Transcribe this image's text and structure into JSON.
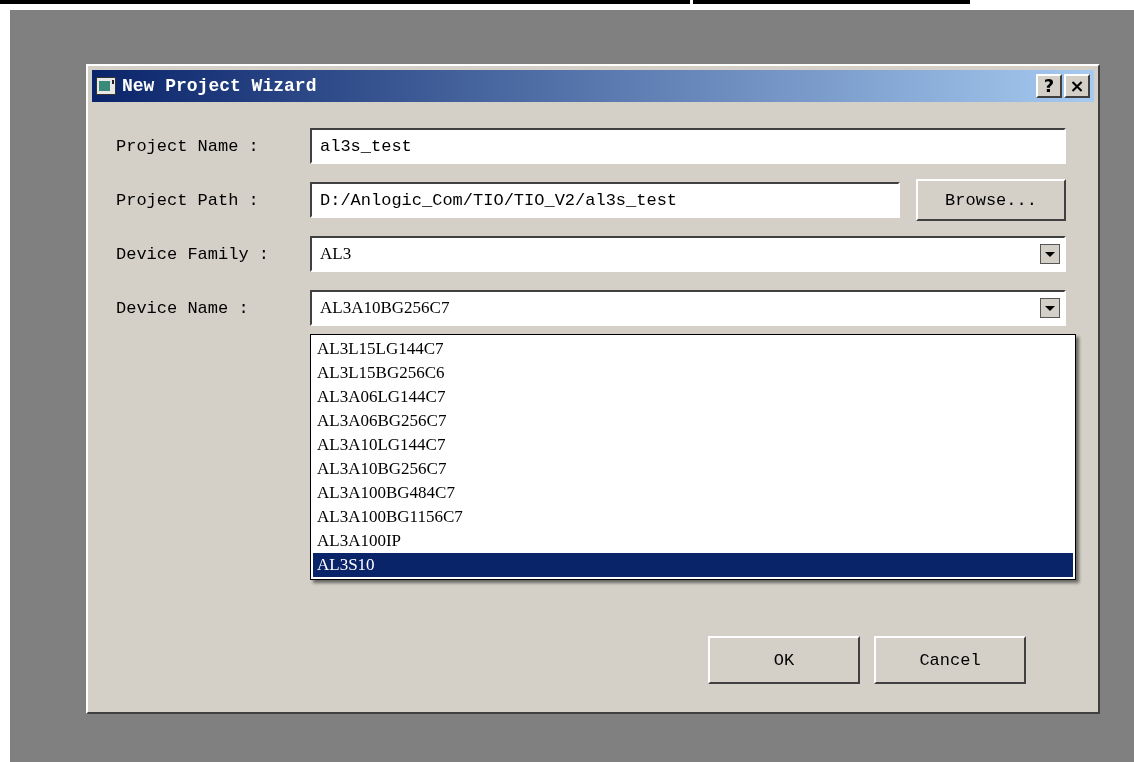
{
  "window": {
    "title": "New Project Wizard",
    "help_button": "?",
    "close_button": "×"
  },
  "fields": [
    {
      "kind": "text",
      "label": "Project Name :",
      "value": "al3s_test"
    },
    {
      "kind": "path",
      "label": "Project Path :",
      "value": "D:/Anlogic_Com/TIO/TIO_V2/al3s_test",
      "button": "Browse..."
    },
    {
      "kind": "combo",
      "label": "Device Family :",
      "value": "AL3"
    },
    {
      "kind": "combo",
      "label": "Device Name :",
      "value": "AL3A10BG256C7"
    }
  ],
  "dropdown": {
    "items": [
      {
        "label": "AL3L15LG144C7",
        "selected": false
      },
      {
        "label": "AL3L15BG256C6",
        "selected": false
      },
      {
        "label": "AL3A06LG144C7",
        "selected": false
      },
      {
        "label": "AL3A06BG256C7",
        "selected": false
      },
      {
        "label": "AL3A10LG144C7",
        "selected": false
      },
      {
        "label": "AL3A10BG256C7",
        "selected": false
      },
      {
        "label": "AL3A100BG484C7",
        "selected": false
      },
      {
        "label": "AL3A100BG1156C7",
        "selected": false
      },
      {
        "label": "AL3A100IP",
        "selected": false
      },
      {
        "label": "AL3S10",
        "selected": true
      }
    ]
  },
  "buttons": [
    "OK",
    "Cancel"
  ]
}
